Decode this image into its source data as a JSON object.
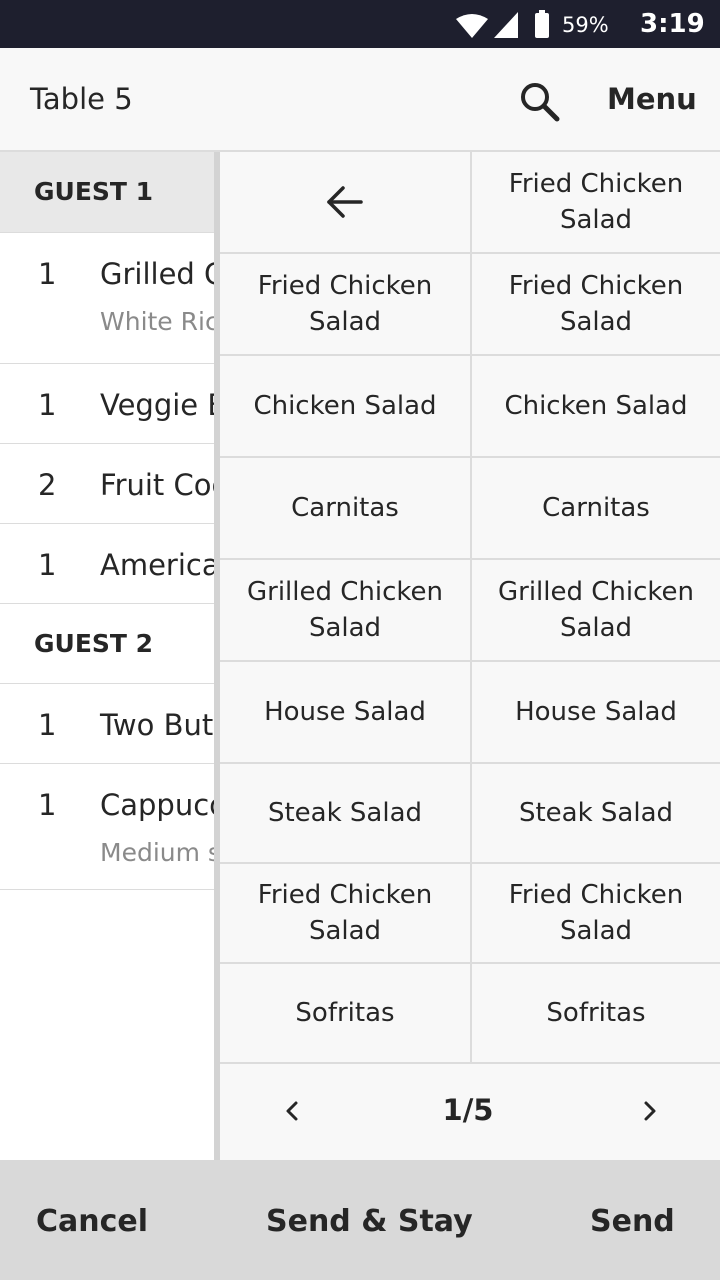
{
  "status_bar": {
    "battery_percent": "59%",
    "time": "3:19",
    "icons": [
      "wifi-icon",
      "cell-signal-icon",
      "battery-icon"
    ]
  },
  "app_bar": {
    "title": "Table 5",
    "search_icon": "search-icon",
    "menu_label": "Menu"
  },
  "order": {
    "guests": [
      {
        "label": "GUEST 1",
        "items": [
          {
            "qty": "1",
            "name": "Grilled Chicken",
            "modifier": "White Rice"
          },
          {
            "qty": "1",
            "name": "Veggie Bowl",
            "modifier": ""
          },
          {
            "qty": "2",
            "name": "Fruit Cocktail",
            "modifier": ""
          },
          {
            "qty": "1",
            "name": "Americano",
            "modifier": ""
          }
        ]
      },
      {
        "label": "GUEST 2",
        "items": [
          {
            "qty": "1",
            "name": "Two Butter Croissants",
            "modifier": ""
          },
          {
            "qty": "1",
            "name": "Cappuccino",
            "modifier": "Medium size"
          }
        ]
      }
    ]
  },
  "menu_grid": {
    "back_icon": "arrow-left-icon",
    "cells": [
      "Fried Chicken Salad",
      "Fried Chicken Salad",
      "Fried Chicken Salad",
      "Chicken Salad",
      "Chicken Salad",
      "Carnitas",
      "Carnitas",
      "Grilled Chicken Salad",
      "Grilled Chicken Salad",
      "House Salad",
      "House Salad",
      "Steak Salad",
      "Steak Salad",
      "Fried Chicken Salad",
      "Fried Chicken Salad",
      "Sofritas",
      "Sofritas"
    ]
  },
  "pager": {
    "label": "1/5",
    "prev_icon": "chevron-left-icon",
    "next_icon": "chevron-right-icon"
  },
  "actions": {
    "cancel": "Cancel",
    "send_stay": "Send & Stay",
    "send": "Send"
  },
  "colors": {
    "status_bar_bg": "#1e1f2e",
    "bottom_bar_bg": "#d9d9d9",
    "text": "#262626",
    "muted_text": "#8a8a8a"
  }
}
